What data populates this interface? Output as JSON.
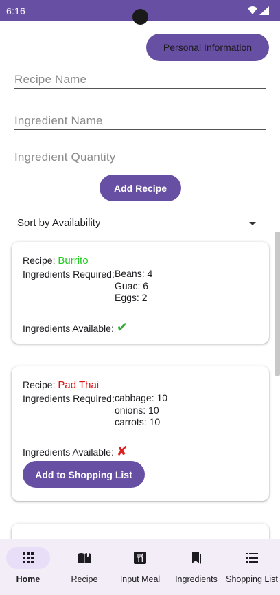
{
  "status": {
    "time": "6:16"
  },
  "header": {
    "personal_button": "Personal Information"
  },
  "form": {
    "recipe_name_placeholder": "Recipe Name",
    "ingredient_name_placeholder": "Ingredient Name",
    "ingredient_quantity_placeholder": "Ingredient Quantity",
    "add_recipe_button": "Add Recipe"
  },
  "sort": {
    "selected": "Sort by Availability"
  },
  "cards": [
    {
      "recipe_label": "Recipe:",
      "recipe_name": "Burrito",
      "available": true,
      "ingredients_label": "Ingredients Required:",
      "ingredients": [
        "Beans: 4",
        "Guac: 6",
        "Eggs: 2"
      ],
      "available_label": "Ingredients Available:",
      "status_icon": "✔"
    },
    {
      "recipe_label": "Recipe:",
      "recipe_name": "Pad Thai",
      "available": false,
      "ingredients_label": "Ingredients Required:",
      "ingredients": [
        "cabbage: 10",
        "onions: 10",
        "carrots: 10"
      ],
      "available_label": "Ingredients Available:",
      "status_icon": "✘",
      "shopping_button": "Add to Shopping List"
    }
  ],
  "nav": [
    {
      "label": "Home",
      "icon": "grid-icon",
      "active": true
    },
    {
      "label": "Recipe",
      "icon": "book-icon",
      "active": false
    },
    {
      "label": "Input Meal",
      "icon": "utensils-icon",
      "active": false
    },
    {
      "label": "Ingredients",
      "icon": "bookmarks-icon",
      "active": false
    },
    {
      "label": "Shopping List",
      "icon": "list-icon",
      "active": false
    }
  ],
  "colors": {
    "primary": "#6750a4",
    "available": "#22cc22",
    "unavailable": "#dd1111",
    "nav_bg": "#f3edf7",
    "nav_active": "#e8def8"
  }
}
